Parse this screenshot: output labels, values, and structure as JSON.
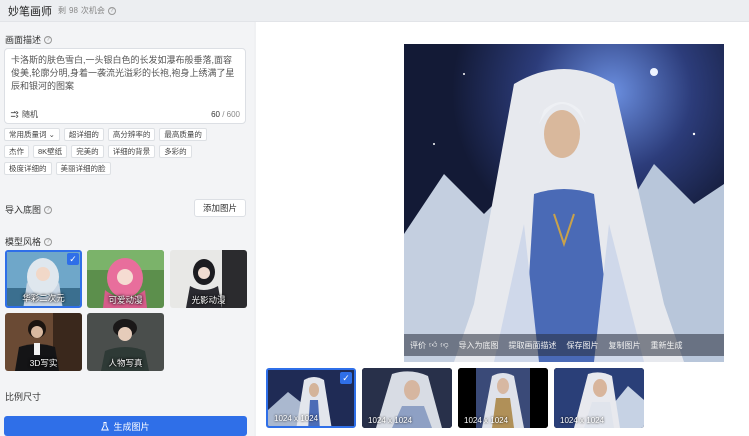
{
  "header": {
    "title": "妙笔画师",
    "credits_prefix": "剩",
    "credits_count": "98",
    "credits_suffix": "次机会"
  },
  "prompt": {
    "label": "画面描述",
    "text": "卡洛斯的肤色雪白,一头银白色的长发如瀑布般垂落,面容俊美,轮廓分明,身着一袭流光溢彩的长袍,袍身上绣满了星辰和银河的图案",
    "random_label": "随机",
    "counter": "60",
    "counter_max": "/ 600"
  },
  "tags": {
    "dropdown": "常用质量词",
    "row1": [
      "超详细的",
      "高分辨率的",
      "最高质量的"
    ],
    "row2": [
      "杰作",
      "8K壁纸",
      "完美的",
      "详细的背景",
      "多彩的"
    ],
    "row3": [
      "极度详细的",
      "美丽详细的脸"
    ]
  },
  "base_image": {
    "label": "导入底图",
    "add_button": "添加图片"
  },
  "model_style": {
    "label": "模型风格",
    "items": [
      {
        "name": "华彩二次元",
        "selected": true
      },
      {
        "name": "可爱动漫",
        "selected": false
      },
      {
        "name": "光影动漫",
        "selected": false
      },
      {
        "name": "3D写实",
        "selected": false
      },
      {
        "name": "人物写真",
        "selected": false
      }
    ]
  },
  "ratio": {
    "label": "比例尺寸"
  },
  "generate_button": "生成图片",
  "preview_toolbar": {
    "rate": "评价",
    "import_base": "导入为底图",
    "extract_desc": "提取画面描述",
    "save": "保存图片",
    "copy": "复制图片",
    "regenerate": "重新生成"
  },
  "thumbnails": [
    {
      "size": "1024 x 1024",
      "selected": true
    },
    {
      "size": "1024 x 1024",
      "selected": false
    },
    {
      "size": "1024 x 1024",
      "selected": false
    },
    {
      "size": "1024 x 1024",
      "selected": false
    }
  ],
  "colors": {
    "accent": "#2f6fe8"
  }
}
